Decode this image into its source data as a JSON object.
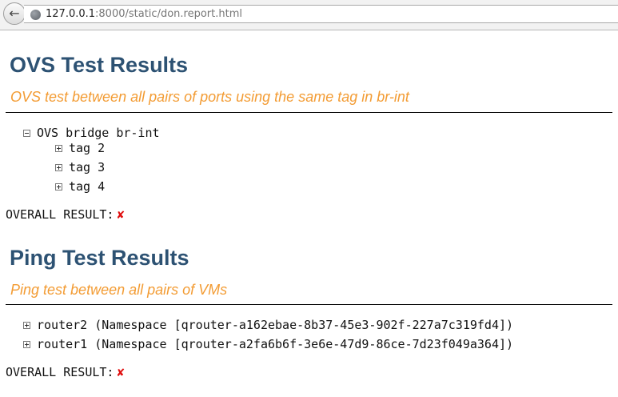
{
  "browser": {
    "back_icon": "back-arrow-icon",
    "url_host": "127.0.0.1",
    "url_rest": ":8000/static/don.report.html"
  },
  "ovs": {
    "title": "OVS Test Results",
    "subtitle": "OVS test between all pairs of ports using the same tag in br-int",
    "bridge_label": "OVS bridge br-int",
    "tags": [
      "tag 2",
      "tag 3",
      "tag 4"
    ],
    "overall_label": "OVERALL RESULT:",
    "overall_mark": "✘"
  },
  "ping": {
    "title": "Ping Test Results",
    "subtitle": "Ping test between all pairs of VMs",
    "routers": [
      "router2 (Namespace [qrouter-a162ebae-8b37-45e3-902f-227a7c319fd4])",
      "router1 (Namespace [qrouter-a2fa6b6f-3e6e-47d9-86ce-7d23f049a364])"
    ],
    "overall_label": "OVERALL RESULT:",
    "overall_mark": "✘"
  },
  "colors": {
    "heading": "#2d5273",
    "subtitle": "#f39c34",
    "fail": "#e01010"
  }
}
